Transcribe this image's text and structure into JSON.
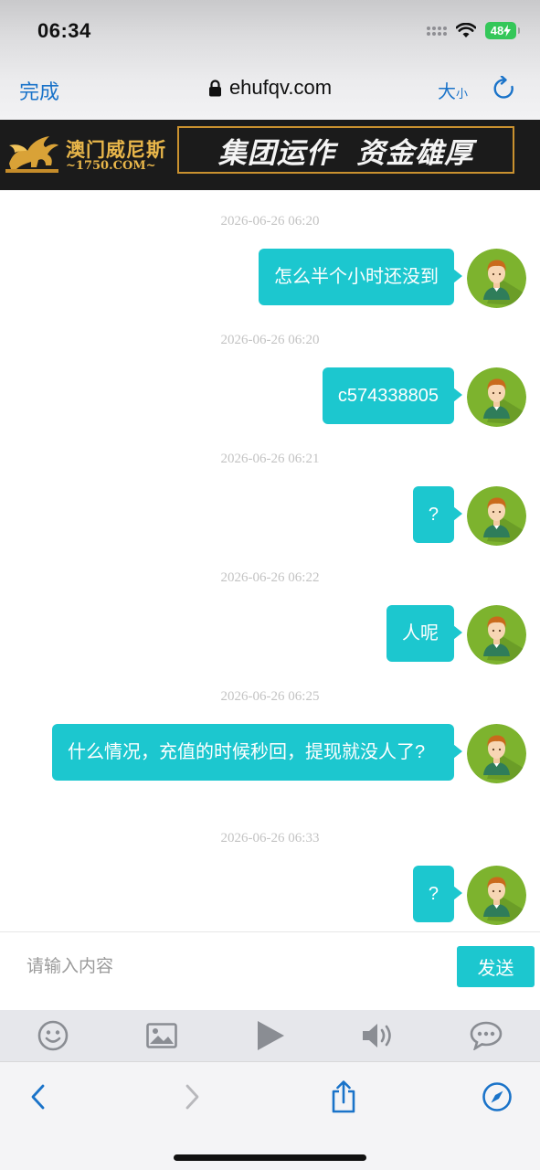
{
  "status_bar": {
    "time": "06:34",
    "battery": "48"
  },
  "browser_nav": {
    "done_label": "完成",
    "url": "ehufqv.com",
    "text_size_big": "大",
    "text_size_small": "小"
  },
  "banner": {
    "brand": "澳门威尼斯",
    "domain": "~1750.COM~",
    "slogan": "集团运作  资金雄厚"
  },
  "messages": [
    {
      "timestamp": "2026-06-26 06:20",
      "text": "怎么半个小时还没到"
    },
    {
      "timestamp": "2026-06-26 06:20",
      "text": "c574338805"
    },
    {
      "timestamp": "2026-06-26 06:21",
      "text": "?"
    },
    {
      "timestamp": "2026-06-26 06:22",
      "text": "人呢"
    },
    {
      "timestamp": "2026-06-26 06:25",
      "text": "什么情况，充值的时候秒回，提现就没人了?"
    },
    {
      "timestamp": "2026-06-26 06:33",
      "text": "?"
    }
  ],
  "composer": {
    "placeholder": "请输入内容",
    "send_label": "发送"
  },
  "tools": [
    "emoji-icon",
    "image-icon",
    "play-icon",
    "speaker-icon",
    "chat-bubble-icon"
  ],
  "colors": {
    "accent": "#1cc7cf",
    "link": "#1a73c9",
    "banner_gold": "#e8b64a"
  }
}
